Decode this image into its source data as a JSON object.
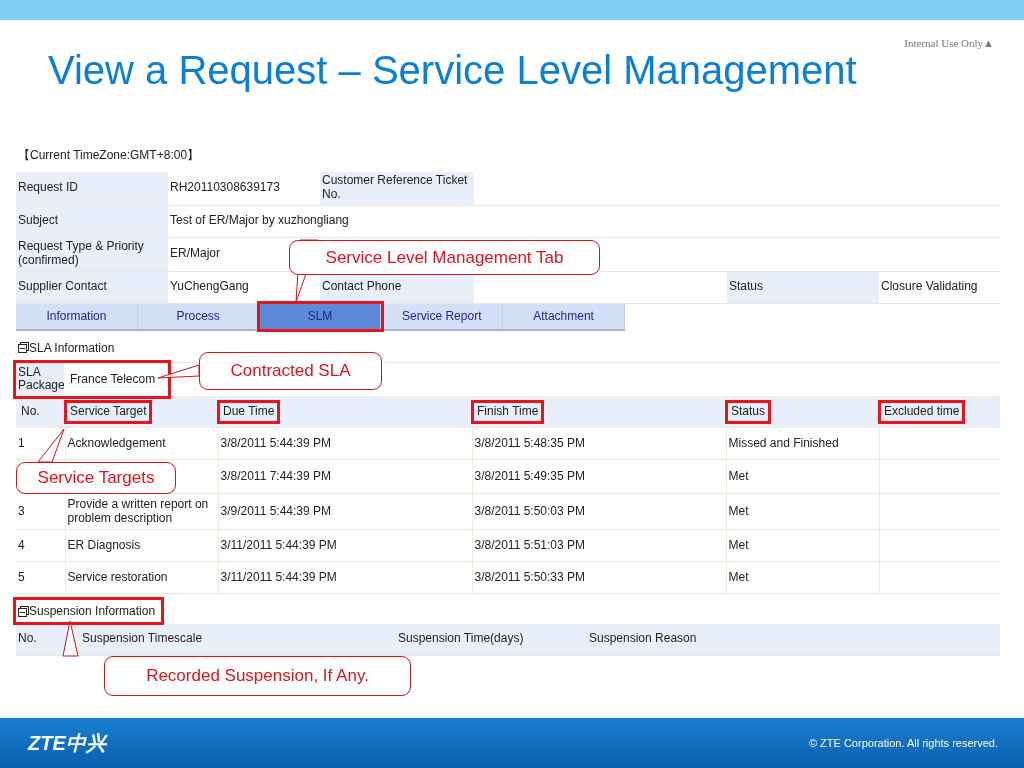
{
  "slide": {
    "classification": "Internal Use Only▲",
    "title": "View a Request – Service Level Management",
    "logo": "ZTE中兴",
    "copyright": "© ZTE Corporation. All rights reserved."
  },
  "timezone": "【Current TimeZone:GMT+8:00】",
  "request_rows": [
    [
      {
        "label": "Request ID",
        "value": "RH20110308639173"
      },
      {
        "label": "Customer Reference Ticket No."
      }
    ],
    [
      {
        "label": "Subject",
        "value": "Test of ER/Major by xuzhongliang"
      }
    ],
    [
      {
        "label": "Request Type & Priority (confirmed)",
        "value": "ER/Major"
      }
    ],
    [
      {
        "label": "Supplier Contact",
        "value": "YuChengGang"
      },
      {
        "label": "Contact Phone"
      },
      {
        "label": "Status",
        "value": "Closure Validating"
      }
    ]
  ],
  "tabs": [
    {
      "label": "Information",
      "selected": false,
      "highlighted": false
    },
    {
      "label": "Process",
      "selected": false,
      "highlighted": false
    },
    {
      "label": "SLM",
      "selected": true,
      "highlighted": true
    },
    {
      "label": "Service Report",
      "selected": false,
      "highlighted": false
    },
    {
      "label": "Attachment",
      "selected": false,
      "highlighted": false
    }
  ],
  "sla_section": {
    "title": "SLA Information",
    "expanded": true,
    "highlighted": false,
    "package_label": "SLA Package",
    "package": "France Telecom",
    "package_highlighted": true
  },
  "targets_table": {
    "columns": [
      {
        "label": "No.",
        "highlighted": false
      },
      {
        "label": "Service Target",
        "highlighted": true
      },
      {
        "label": "Due Time",
        "highlighted": true
      },
      {
        "label": "Finish Time",
        "highlighted": true
      },
      {
        "label": "Status",
        "highlighted": true
      },
      {
        "label": "Excluded time",
        "highlighted": true
      }
    ],
    "rows": [
      {
        "no": "1",
        "target": "Acknowledgement",
        "due": "3/8/2011 5:44:39 PM",
        "finish": "3/8/2011 5:48:35 PM",
        "status": "Missed and Finished"
      },
      {
        "due": "3/8/2011 7:44:39 PM",
        "finish": "3/8/2011 5:49:35 PM",
        "status": "Met"
      },
      {
        "no": "3",
        "target": "Provide a written report on problem description",
        "due": "3/9/2011 5:44:39 PM",
        "finish": "3/8/2011 5:50:03 PM",
        "status": "Met"
      },
      {
        "no": "4",
        "target": "ER Diagnosis",
        "due": "3/11/2011 5:44:39 PM",
        "finish": "3/8/2011 5:51:03 PM",
        "status": "Met"
      },
      {
        "no": "5",
        "target": "Service restoration",
        "due": "3/11/2011 5:44:39 PM",
        "finish": "3/8/2011 5:50:33 PM",
        "status": "Met"
      }
    ]
  },
  "suspension_section": {
    "title": "Suspension Information",
    "expanded": true,
    "highlighted": true
  },
  "suspension_table": {
    "columns": [
      {
        "label": "No."
      },
      {
        "label": "Suspension Timescale"
      },
      {
        "label": "Suspension Time(days)"
      },
      {
        "label": "Suspension Reason"
      }
    ]
  },
  "callouts": [
    {
      "text": "Service Level Management Tab"
    },
    {
      "text": "Contracted SLA"
    },
    {
      "text": "Service Targets"
    },
    {
      "text": "Recorded Suspension, If Any."
    }
  ]
}
